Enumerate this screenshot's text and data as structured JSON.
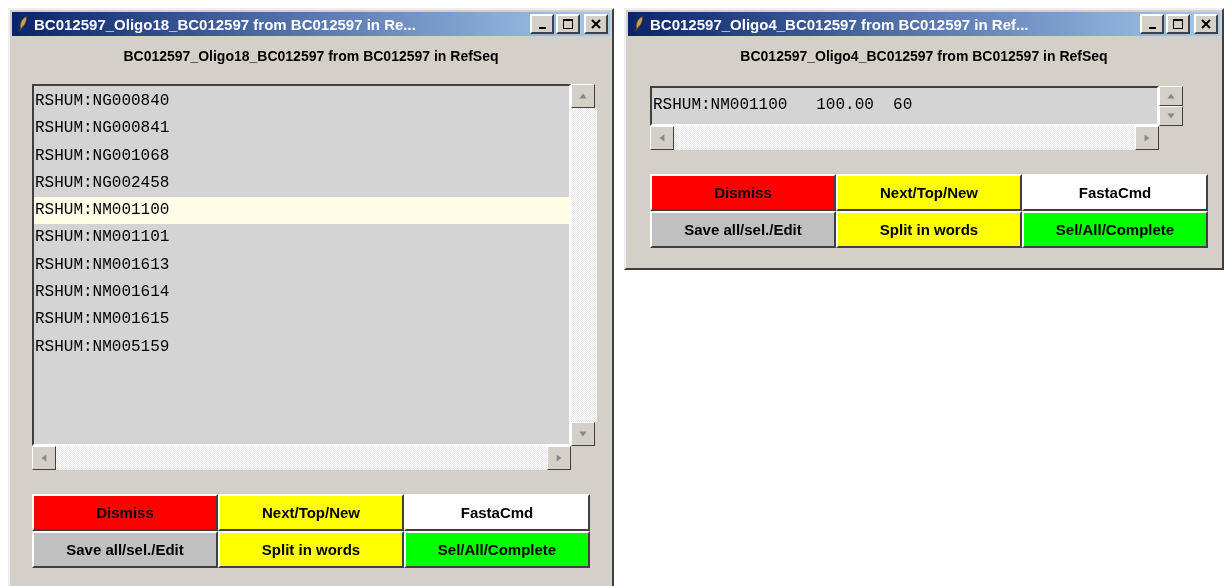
{
  "windows": [
    {
      "title": "BC012597_Oligo18_BC012597 from BC012597 in Re...",
      "heading": "BC012597_Oligo18_BC012597 from BC012597 in RefSeq",
      "rows": [
        {
          "text": "RSHUM:NG000840",
          "selected": false
        },
        {
          "text": "RSHUM:NG000841",
          "selected": false
        },
        {
          "text": "RSHUM:NG001068",
          "selected": false
        },
        {
          "text": "RSHUM:NG002458",
          "selected": false
        },
        {
          "text": "RSHUM:NM001100",
          "selected": true
        },
        {
          "text": "RSHUM:NM001101",
          "selected": false
        },
        {
          "text": "RSHUM:NM001613",
          "selected": false
        },
        {
          "text": "RSHUM:NM001614",
          "selected": false
        },
        {
          "text": "RSHUM:NM001615",
          "selected": false
        },
        {
          "text": "RSHUM:NM005159",
          "selected": false
        }
      ],
      "buttons": [
        {
          "label": "Dismiss",
          "color": "#ff0000"
        },
        {
          "label": "Next/Top/New",
          "color": "#ffff00"
        },
        {
          "label": "FastaCmd",
          "color": "#ffffff"
        },
        {
          "label": "Save all/sel./Edit",
          "color": "#c0c0c0"
        },
        {
          "label": "Split in words",
          "color": "#ffff00"
        },
        {
          "label": "Sel/All/Complete",
          "color": "#00ff00"
        }
      ]
    },
    {
      "title": "BC012597_Oligo4_BC012597 from BC012597 in Ref...",
      "heading": "BC012597_Oligo4_BC012597 from BC012597 in RefSeq",
      "rows": [
        {
          "text": "RSHUM:NM001100   100.00  60",
          "selected": false
        }
      ],
      "buttons": [
        {
          "label": "Dismiss",
          "color": "#ff0000"
        },
        {
          "label": "Next/Top/New",
          "color": "#ffff00"
        },
        {
          "label": "FastaCmd",
          "color": "#ffffff"
        },
        {
          "label": "Save all/sel./Edit",
          "color": "#c0c0c0"
        },
        {
          "label": "Split in words",
          "color": "#ffff00"
        },
        {
          "label": "Sel/All/Complete",
          "color": "#00ff00"
        }
      ]
    }
  ]
}
